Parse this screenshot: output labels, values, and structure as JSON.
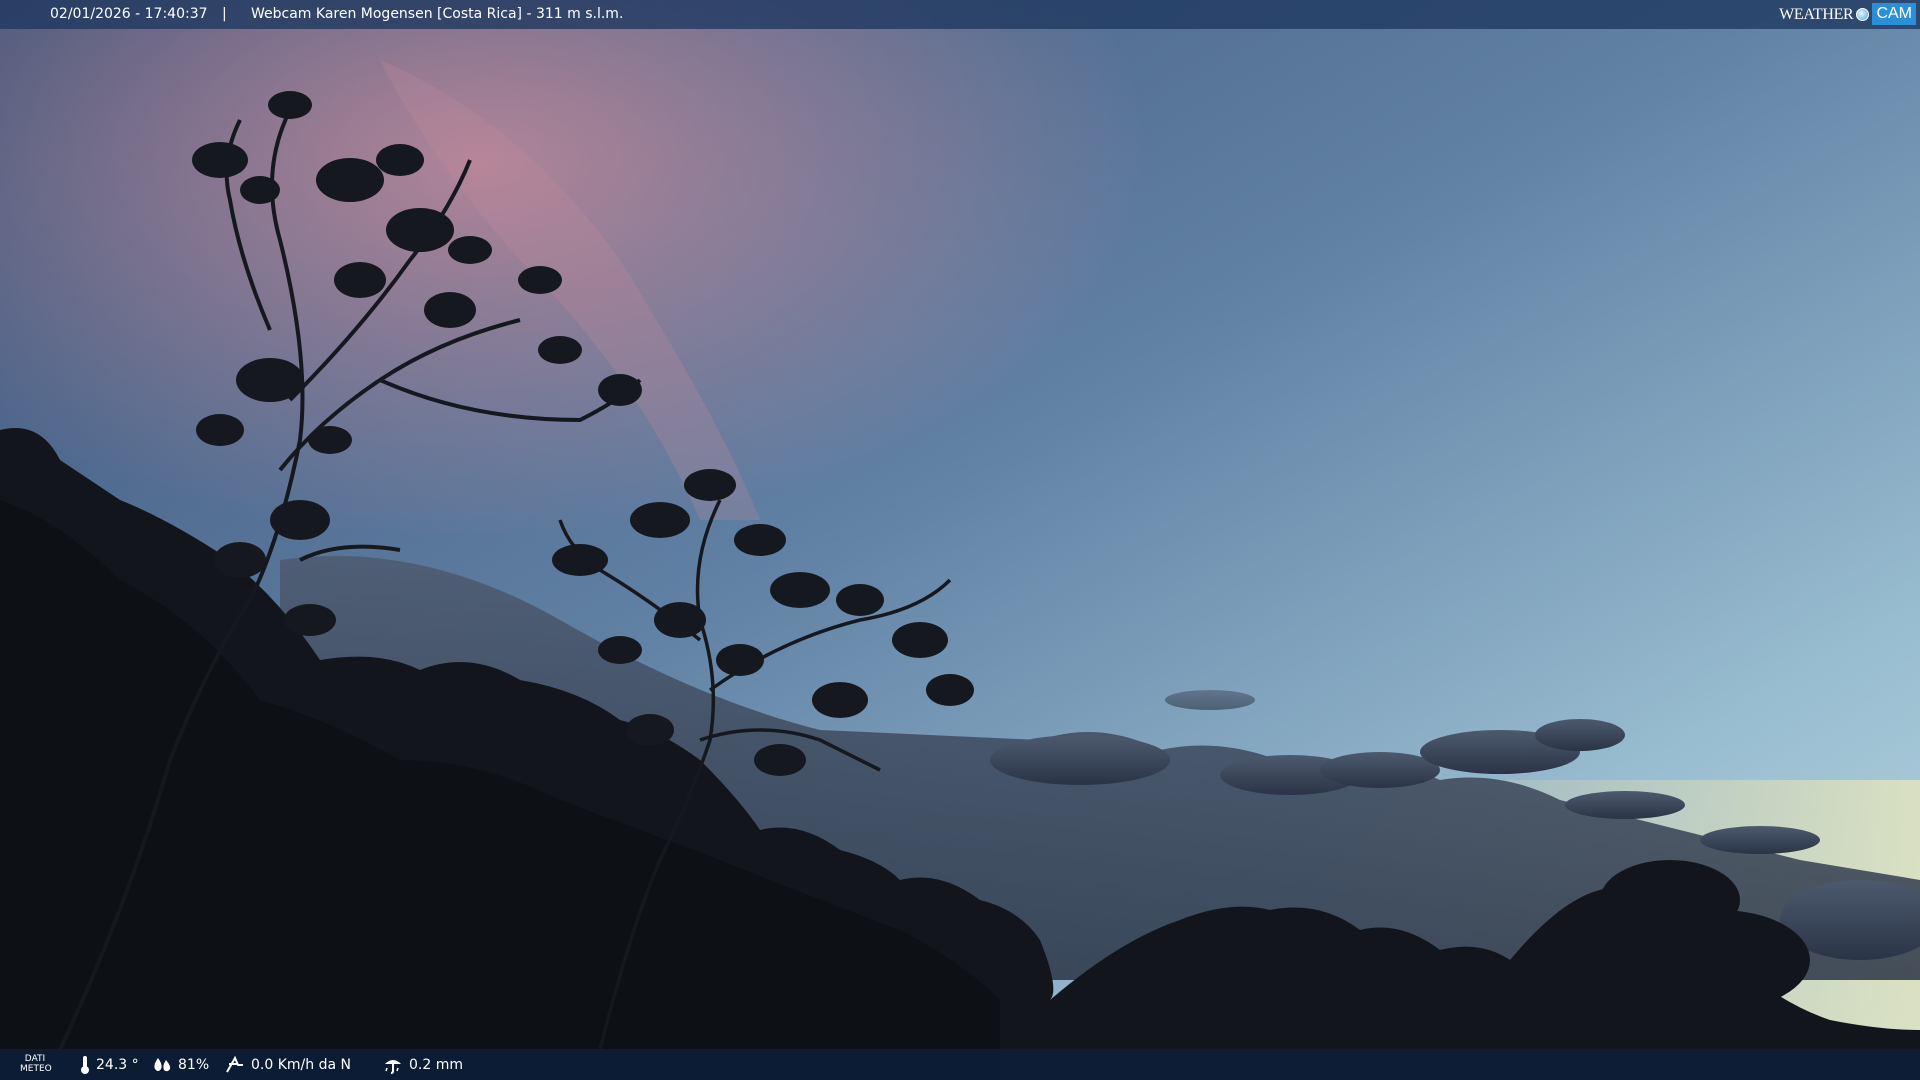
{
  "top_bar": {
    "datetime": "02/01/2026 - 17:40:37",
    "separator": "|",
    "title": "Webcam Karen Mogensen [Costa Rica]  - 311 m s.l.m."
  },
  "logo": {
    "weather": "WEATHER",
    "cam": "CAM"
  },
  "bottom_bar": {
    "label_line1": "DATI",
    "label_line2": "METEO",
    "temperature": "24.3 °",
    "humidity": "81%",
    "wind": "0.0 Km/h da N",
    "rain": "0.2 mm"
  },
  "colors": {
    "sky_top": "#4a5f86",
    "sky_bottom": "#a8c6d6",
    "pink_glow": "#c9879a",
    "foliage": "#12161c",
    "bar_top": "#1e375f",
    "bar_bottom": "#0c1e3a"
  }
}
